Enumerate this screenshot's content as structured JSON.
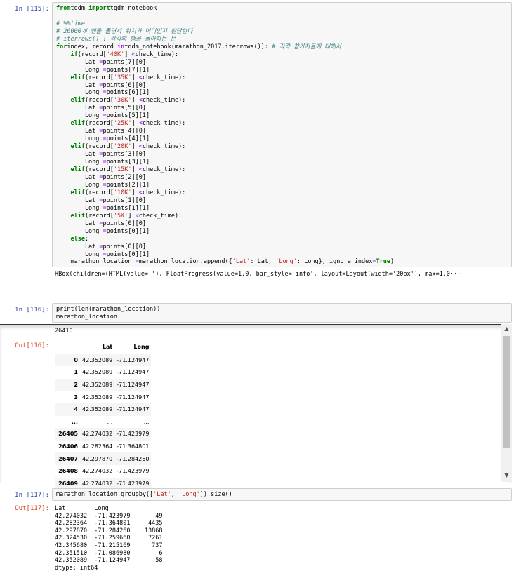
{
  "cells": {
    "c115": {
      "prompt": "In [115]:",
      "lines": [
        [
          [
            "kw",
            "from"
          ],
          [
            "",
            "tqdm "
          ],
          [
            "kw",
            "import"
          ],
          [
            "",
            "tqdm_notebook"
          ]
        ],
        [
          [
            "",
            ""
          ]
        ],
        [
          [
            "cm",
            "# %%time"
          ]
        ],
        [
          [
            "cm",
            "# 26000개 행을 돌면서 위치가 어디인지 판단한다."
          ]
        ],
        [
          [
            "cm",
            "# iterrows() : 각각의 행을 돌아하는 문"
          ]
        ],
        [
          [
            "kw",
            "for"
          ],
          [
            "",
            "index, record "
          ],
          [
            "op",
            "in"
          ],
          [
            "",
            "tqdm_notebook(marathon_2017.iterrows()): "
          ],
          [
            "cm",
            "# 각각 참가자들에 대해서"
          ]
        ],
        [
          [
            "",
            "    "
          ],
          [
            "kw",
            "if"
          ],
          [
            "",
            "(record["
          ],
          [
            "str",
            "'40K'"
          ],
          [
            "",
            "] "
          ],
          [
            "op",
            "<"
          ],
          [
            "",
            "check_time):"
          ]
        ],
        [
          [
            "",
            "        Lat "
          ],
          [
            "op",
            "="
          ],
          [
            "",
            "points[7][0]"
          ]
        ],
        [
          [
            "",
            "        Long "
          ],
          [
            "op",
            "="
          ],
          [
            "",
            "points[7][1]"
          ]
        ],
        [
          [
            "",
            "    "
          ],
          [
            "kw",
            "elif"
          ],
          [
            "",
            "(record["
          ],
          [
            "str",
            "'35K'"
          ],
          [
            "",
            "] "
          ],
          [
            "op",
            "<"
          ],
          [
            "",
            "check_time):"
          ]
        ],
        [
          [
            "",
            "        Lat "
          ],
          [
            "op",
            "="
          ],
          [
            "",
            "points[6][0]"
          ]
        ],
        [
          [
            "",
            "        Long "
          ],
          [
            "op",
            "="
          ],
          [
            "",
            "points[6][1]"
          ]
        ],
        [
          [
            "",
            "    "
          ],
          [
            "kw",
            "elif"
          ],
          [
            "",
            "(record["
          ],
          [
            "str",
            "'30K'"
          ],
          [
            "",
            "] "
          ],
          [
            "op",
            "<"
          ],
          [
            "",
            "check_time):"
          ]
        ],
        [
          [
            "",
            "        Lat "
          ],
          [
            "op",
            "="
          ],
          [
            "",
            "points[5][0]"
          ]
        ],
        [
          [
            "",
            "        Long "
          ],
          [
            "op",
            "="
          ],
          [
            "",
            "points[5][1]"
          ]
        ],
        [
          [
            "",
            "    "
          ],
          [
            "kw",
            "elif"
          ],
          [
            "",
            "(record["
          ],
          [
            "str",
            "'25K'"
          ],
          [
            "",
            "] "
          ],
          [
            "op",
            "<"
          ],
          [
            "",
            "check_time):"
          ]
        ],
        [
          [
            "",
            "        Lat "
          ],
          [
            "op",
            "="
          ],
          [
            "",
            "points[4][0]"
          ]
        ],
        [
          [
            "",
            "        Long "
          ],
          [
            "op",
            "="
          ],
          [
            "",
            "points[4][1]"
          ]
        ],
        [
          [
            "",
            "    "
          ],
          [
            "kw",
            "elif"
          ],
          [
            "",
            "(record["
          ],
          [
            "str",
            "'20K'"
          ],
          [
            "",
            "] "
          ],
          [
            "op",
            "<"
          ],
          [
            "",
            "check_time):"
          ]
        ],
        [
          [
            "",
            "        Lat "
          ],
          [
            "op",
            "="
          ],
          [
            "",
            "points[3][0]"
          ]
        ],
        [
          [
            "",
            "        Long "
          ],
          [
            "op",
            "="
          ],
          [
            "",
            "points[3][1]"
          ]
        ],
        [
          [
            "",
            "    "
          ],
          [
            "kw",
            "elif"
          ],
          [
            "",
            "(record["
          ],
          [
            "str",
            "'15K'"
          ],
          [
            "",
            "] "
          ],
          [
            "op",
            "<"
          ],
          [
            "",
            "check_time):"
          ]
        ],
        [
          [
            "",
            "        Lat "
          ],
          [
            "op",
            "="
          ],
          [
            "",
            "points[2][0]"
          ]
        ],
        [
          [
            "",
            "        Long "
          ],
          [
            "op",
            "="
          ],
          [
            "",
            "points[2][1]"
          ]
        ],
        [
          [
            "",
            "    "
          ],
          [
            "kw",
            "elif"
          ],
          [
            "",
            "(record["
          ],
          [
            "str",
            "'10K'"
          ],
          [
            "",
            "] "
          ],
          [
            "op",
            "<"
          ],
          [
            "",
            "check_time):"
          ]
        ],
        [
          [
            "",
            "        Lat "
          ],
          [
            "op",
            "="
          ],
          [
            "",
            "points[1][0]"
          ]
        ],
        [
          [
            "",
            "        Long "
          ],
          [
            "op",
            "="
          ],
          [
            "",
            "points[1][1]"
          ]
        ],
        [
          [
            "",
            "    "
          ],
          [
            "kw",
            "elif"
          ],
          [
            "",
            "(record["
          ],
          [
            "str",
            "'5K'"
          ],
          [
            "",
            "] "
          ],
          [
            "op",
            "<"
          ],
          [
            "",
            "check_time):"
          ]
        ],
        [
          [
            "",
            "        Lat "
          ],
          [
            "op",
            "="
          ],
          [
            "",
            "points[0][0]"
          ]
        ],
        [
          [
            "",
            "        Long "
          ],
          [
            "op",
            "="
          ],
          [
            "",
            "points[0][1]"
          ]
        ],
        [
          [
            "",
            "    "
          ],
          [
            "kw",
            "else"
          ],
          [
            "",
            ":"
          ]
        ],
        [
          [
            "",
            "        Lat "
          ],
          [
            "op",
            "="
          ],
          [
            "",
            "points[0][0]"
          ]
        ],
        [
          [
            "",
            "        Long "
          ],
          [
            "op",
            "="
          ],
          [
            "",
            "points[0][1]"
          ]
        ],
        [
          [
            "",
            "    marathon_location "
          ],
          [
            "op",
            "="
          ],
          [
            "",
            "marathon_location.append({"
          ],
          [
            "str",
            "'Lat'"
          ],
          [
            "",
            ": Lat, "
          ],
          [
            "str",
            "'Long'"
          ],
          [
            "",
            ": Long}, ignore_index"
          ],
          [
            "op",
            "="
          ],
          [
            "kw",
            "True"
          ],
          [
            "",
            ")"
          ]
        ]
      ],
      "output": "HBox(children=(HTML(value=''), FloatProgress(value=1.0, bar_style='info', layout=Layout(width='20px'), max=1.0···"
    },
    "c116": {
      "prompt": "In [116]:",
      "out_prompt": "Out[116]:",
      "lines": [
        [
          [
            "",
            "print(len(marathon_location))"
          ]
        ],
        [
          [
            "",
            "marathon_location"
          ]
        ]
      ],
      "print_output": "26410",
      "table": {
        "columns": [
          "Lat",
          "Long"
        ],
        "rows": [
          [
            "0",
            "42.352089",
            "-71.124947"
          ],
          [
            "1",
            "42.352089",
            "-71.124947"
          ],
          [
            "2",
            "42.352089",
            "-71.124947"
          ],
          [
            "3",
            "42.352089",
            "-71.124947"
          ],
          [
            "4",
            "42.352089",
            "-71.124947"
          ],
          [
            "...",
            "...",
            "..."
          ],
          [
            "26405",
            "42.274032",
            "-71.423979"
          ],
          [
            "26406",
            "42.282364",
            "-71.364801"
          ],
          [
            "26407",
            "42.297870",
            "-71.284260"
          ],
          [
            "26408",
            "42.274032",
            "-71.423979"
          ],
          [
            "26409",
            "42.274032",
            "-71.423979"
          ]
        ]
      }
    },
    "c117": {
      "prompt": "In [117]:",
      "out_prompt": "Out[117]:",
      "lines": [
        [
          [
            "",
            "marathon_location.groupby(["
          ],
          [
            "str",
            "'Lat'"
          ],
          [
            "",
            ", "
          ],
          [
            "str",
            "'Long'"
          ],
          [
            "",
            "]).size()"
          ]
        ]
      ],
      "output": "Lat        Long      \n42.274032  -71.423979       49\n42.282364  -71.364801     4435\n42.297870  -71.284260    13868\n42.324530  -71.259660     7261\n42.345680  -71.215169      737\n42.351510  -71.086980        6\n42.352089  -71.124947       58\ndtype: int64"
    }
  },
  "scrollbar": {
    "up_icon": "▲",
    "down_icon": "▼"
  }
}
